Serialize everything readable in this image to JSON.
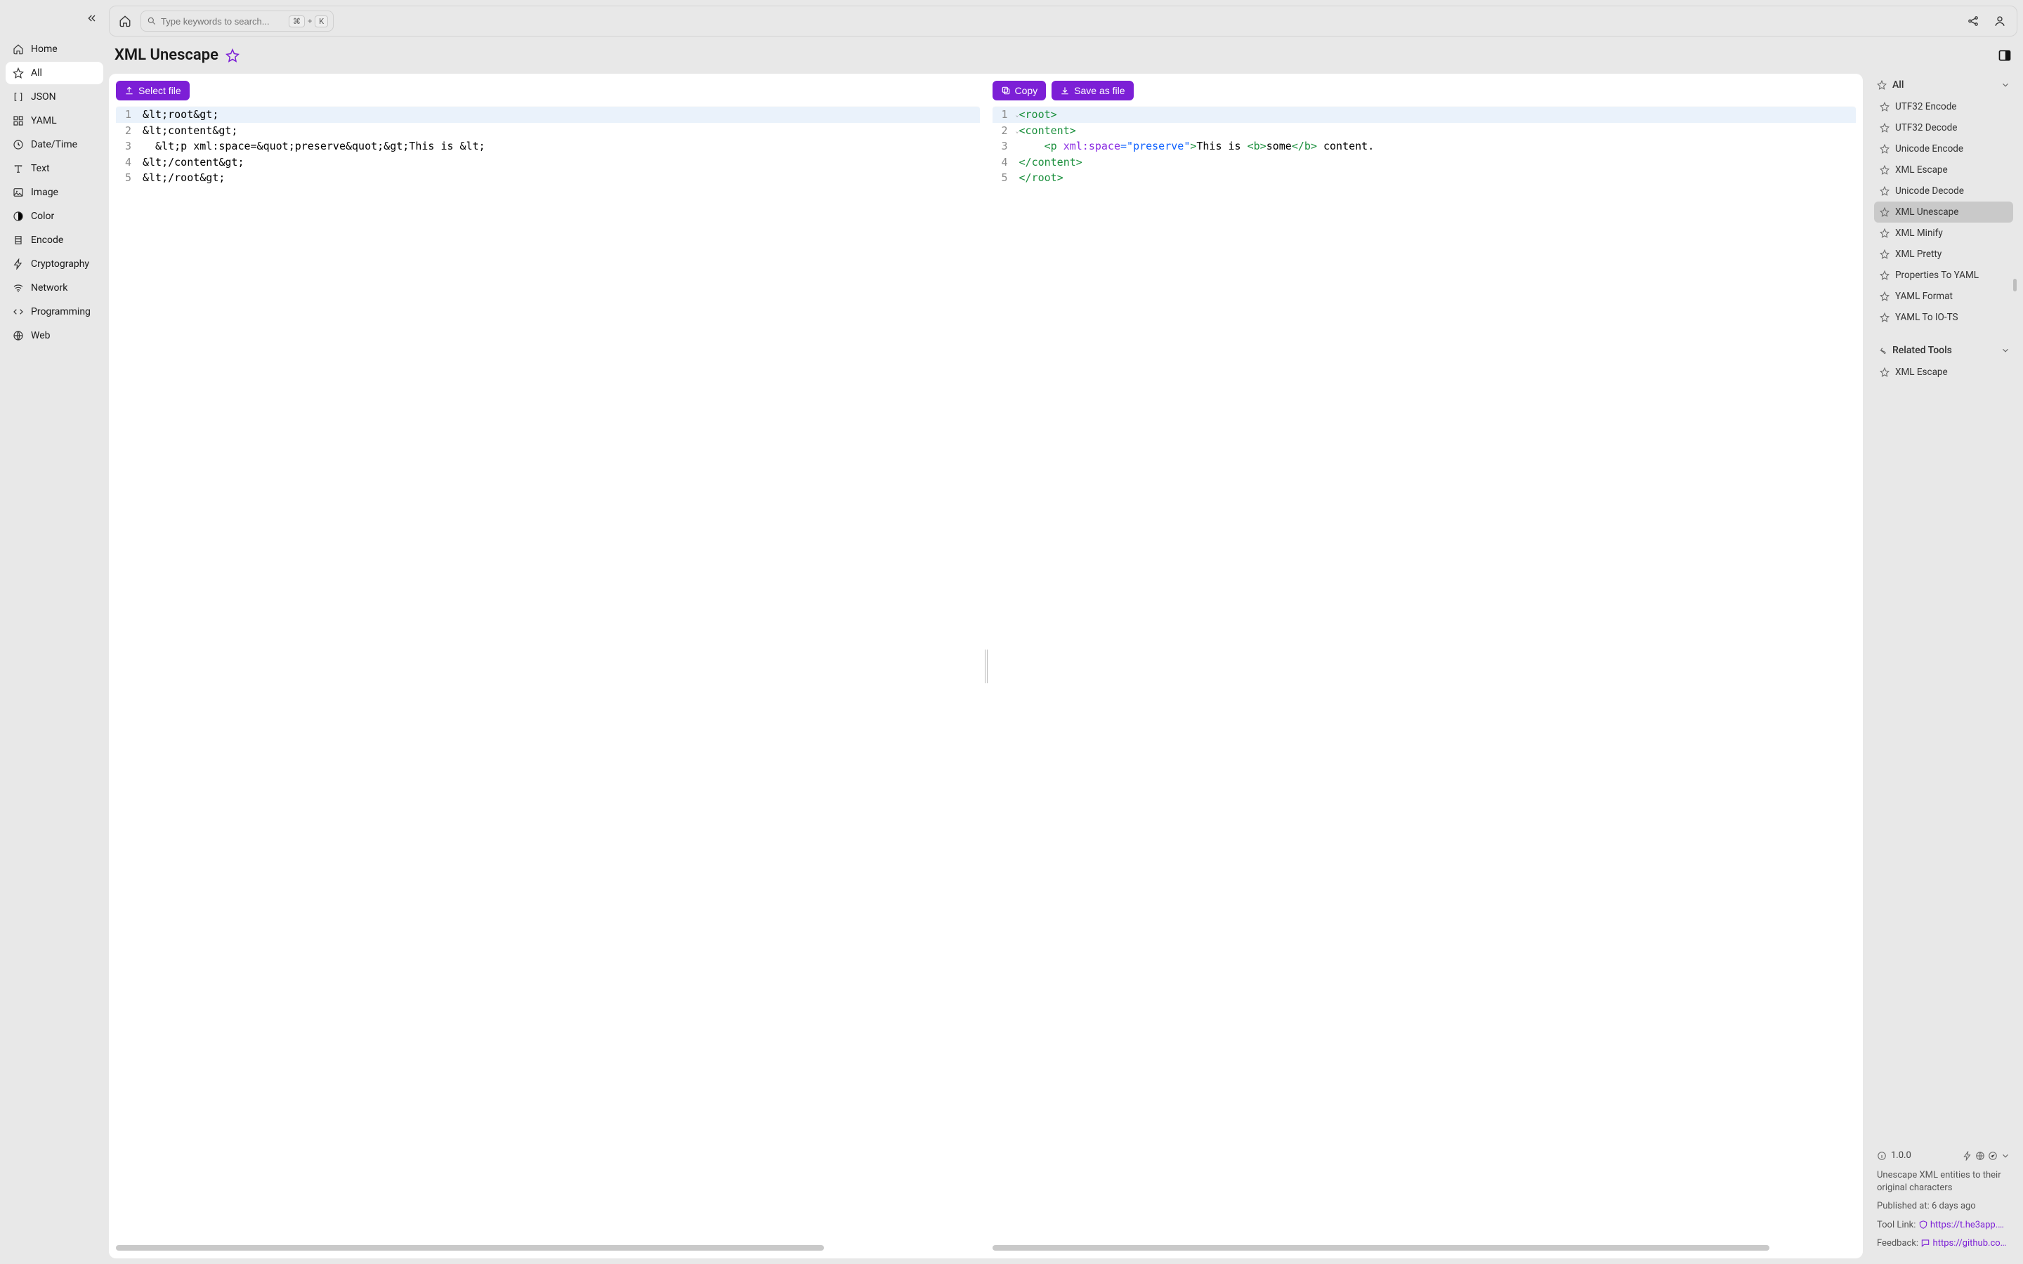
{
  "sidebar": {
    "items": [
      {
        "label": "Home"
      },
      {
        "label": "All"
      },
      {
        "label": "JSON"
      },
      {
        "label": "YAML"
      },
      {
        "label": "Date/Time"
      },
      {
        "label": "Text"
      },
      {
        "label": "Image"
      },
      {
        "label": "Color"
      },
      {
        "label": "Encode"
      },
      {
        "label": "Cryptography"
      },
      {
        "label": "Network"
      },
      {
        "label": "Programming"
      },
      {
        "label": "Web"
      }
    ]
  },
  "search": {
    "placeholder": "Type keywords to search...",
    "kbd1": "⌘",
    "plus": "+",
    "kbd2": "K"
  },
  "page": {
    "title": "XML Unescape"
  },
  "buttons": {
    "select_file": "Select file",
    "copy": "Copy",
    "save_as_file": "Save as file"
  },
  "input_lines": [
    "&lt;root&gt;",
    "&lt;content&gt;",
    "  &lt;p xml:space=&quot;preserve&quot;&gt;This is &lt;",
    "&lt;/content&gt;",
    "&lt;/root&gt;"
  ],
  "output_raw": {
    "l1": {
      "open": "<",
      "tag": "root",
      "close": ">"
    },
    "l2": {
      "open": "<",
      "tag": "content",
      "close": ">"
    },
    "l3": {
      "indent": "    ",
      "open": "<",
      "tag": "p",
      "sp": " ",
      "attr": "xml:space",
      "eq": "=\"",
      "val": "preserve",
      "eq2": "\"",
      "close": ">",
      "t1": "This is ",
      "bopen": "<",
      "btag": "b",
      "bclose": ">",
      "t2": "some",
      "bcopen": "</",
      "bctag": "b",
      "bcclose": ">",
      "t3": " content."
    },
    "l4": {
      "open": "</",
      "tag": "content",
      "close": ">"
    },
    "l5": {
      "open": "</",
      "tag": "root",
      "close": ">"
    }
  },
  "right": {
    "all_header": "All",
    "tools": [
      "UTF32 Encode",
      "UTF32 Decode",
      "Unicode Encode",
      "XML Escape",
      "Unicode Decode",
      "XML Unescape",
      "XML Minify",
      "XML Pretty",
      "Properties To YAML",
      "YAML Format",
      "YAML To IO-TS"
    ],
    "related_header": "Related Tools",
    "related": [
      "XML Escape"
    ],
    "version": "1.0.0",
    "desc": "Unescape XML entities to their original characters",
    "published_label": "Published at: ",
    "published_value": "6 days ago",
    "tool_link_label": "Tool Link: ",
    "tool_link": "https://t.he3app.co…",
    "feedback_label": "Feedback: ",
    "feedback_link": "https://github.com/…"
  }
}
